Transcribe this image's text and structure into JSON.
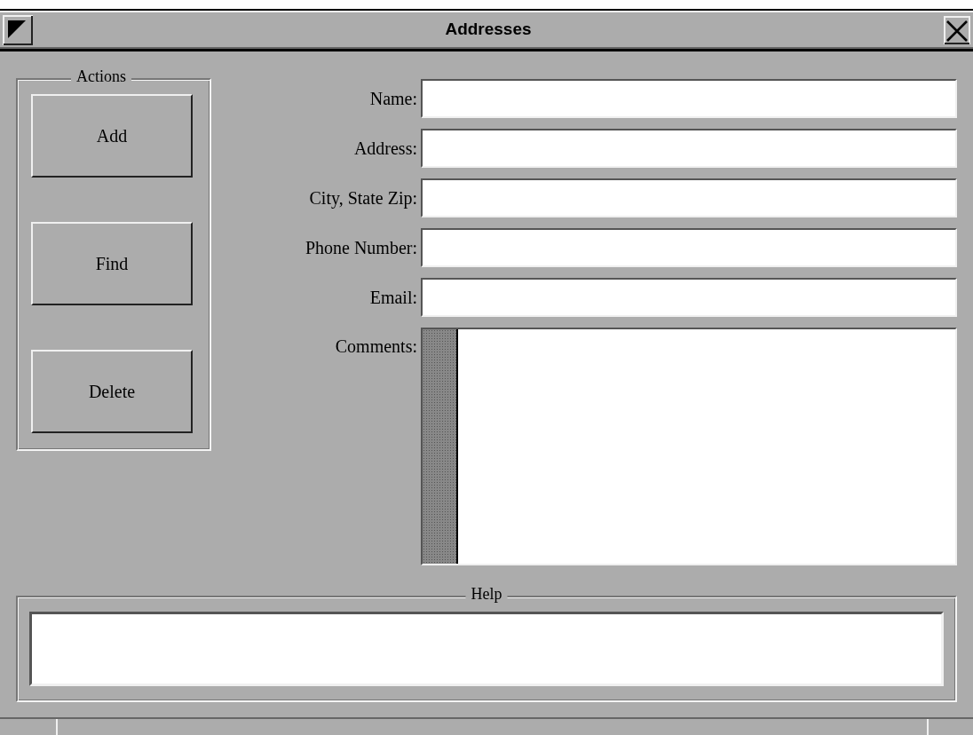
{
  "window": {
    "title": "Addresses"
  },
  "actions": {
    "title": "Actions",
    "buttons": [
      "Add",
      "Find",
      "Delete"
    ]
  },
  "fields": [
    {
      "label": "Name:",
      "kind": "line"
    },
    {
      "label": "Address:",
      "kind": "line"
    },
    {
      "label": "City, State Zip:",
      "kind": "line"
    },
    {
      "label": "Phone Number:",
      "kind": "line"
    },
    {
      "label": "Email:",
      "kind": "line"
    },
    {
      "label": "Comments:",
      "kind": "multiline"
    }
  ],
  "help": {
    "title": "Help"
  }
}
